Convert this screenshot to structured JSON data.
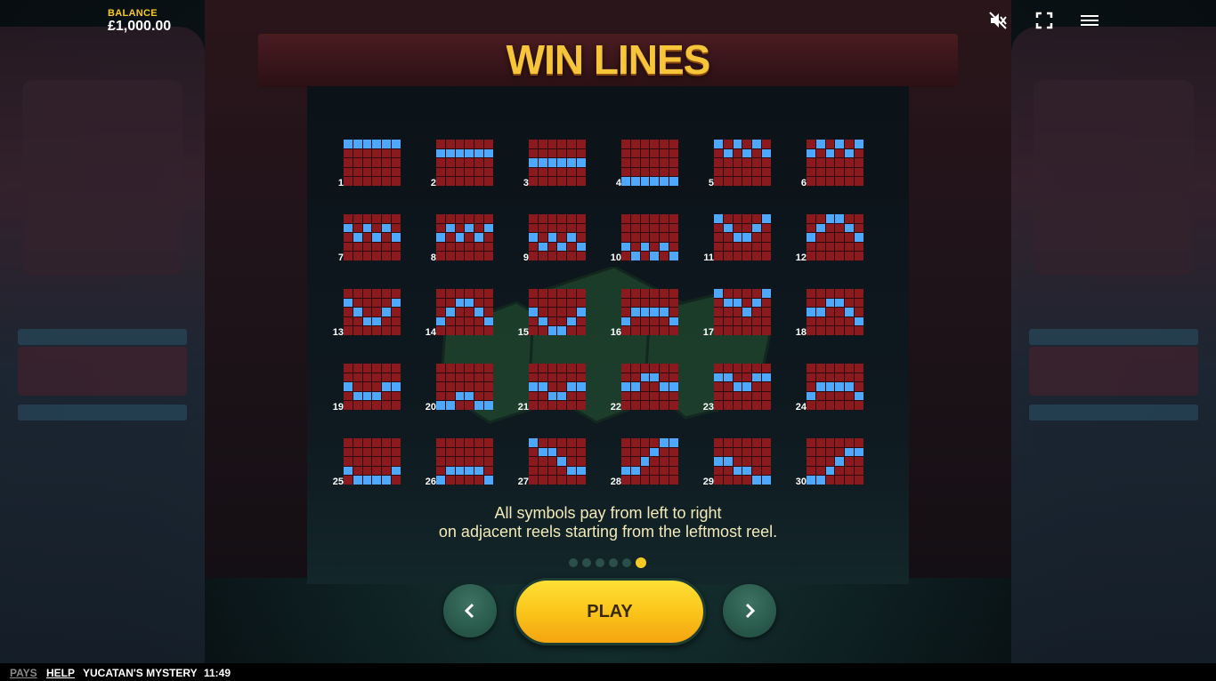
{
  "balance": {
    "label": "BALANCE",
    "value": "£1,000.00"
  },
  "top_icons": {
    "mute": "speaker-muted-icon",
    "fullscreen": "fullscreen-icon",
    "menu": "hamburger-menu-icon"
  },
  "title": "WIN LINES",
  "win_lines": [
    {
      "number": "1",
      "pattern": [
        0,
        0,
        0,
        0,
        0,
        0
      ]
    },
    {
      "number": "2",
      "pattern": [
        1,
        1,
        1,
        1,
        1,
        1
      ]
    },
    {
      "number": "3",
      "pattern": [
        2,
        2,
        2,
        2,
        2,
        2
      ]
    },
    {
      "number": "4",
      "pattern": [
        4,
        4,
        4,
        4,
        4,
        4
      ]
    },
    {
      "number": "5",
      "pattern": [
        0,
        1,
        0,
        1,
        0,
        1
      ]
    },
    {
      "number": "6",
      "pattern": [
        1,
        0,
        1,
        0,
        1,
        0
      ]
    },
    {
      "number": "7",
      "pattern": [
        1,
        2,
        1,
        2,
        1,
        2
      ]
    },
    {
      "number": "8",
      "pattern": [
        2,
        1,
        2,
        1,
        2,
        1
      ]
    },
    {
      "number": "9",
      "pattern": [
        2,
        3,
        2,
        3,
        2,
        3
      ]
    },
    {
      "number": "10",
      "pattern": [
        3,
        4,
        3,
        4,
        3,
        4
      ]
    },
    {
      "number": "11",
      "pattern": [
        0,
        1,
        2,
        2,
        1,
        0
      ]
    },
    {
      "number": "12",
      "pattern": [
        2,
        1,
        0,
        0,
        1,
        2
      ]
    },
    {
      "number": "13",
      "pattern": [
        1,
        2,
        3,
        3,
        2,
        1
      ]
    },
    {
      "number": "14",
      "pattern": [
        3,
        2,
        1,
        1,
        2,
        3
      ]
    },
    {
      "number": "15",
      "pattern": [
        2,
        3,
        4,
        4,
        3,
        2
      ]
    },
    {
      "number": "16",
      "pattern": [
        3,
        2,
        2,
        2,
        2,
        3
      ]
    },
    {
      "number": "17",
      "pattern": [
        0,
        1,
        1,
        2,
        1,
        0
      ]
    },
    {
      "number": "18",
      "pattern": [
        2,
        2,
        1,
        1,
        2,
        3
      ]
    },
    {
      "number": "19",
      "pattern": [
        2,
        3,
        3,
        3,
        2,
        2
      ]
    },
    {
      "number": "20",
      "pattern": [
        4,
        4,
        3,
        3,
        4,
        4
      ]
    },
    {
      "number": "21",
      "pattern": [
        2,
        2,
        3,
        3,
        2,
        2
      ]
    },
    {
      "number": "22",
      "pattern": [
        2,
        2,
        1,
        1,
        2,
        2
      ]
    },
    {
      "number": "23",
      "pattern": [
        1,
        1,
        2,
        2,
        1,
        1
      ]
    },
    {
      "number": "24",
      "pattern": [
        3,
        2,
        2,
        2,
        2,
        3
      ]
    },
    {
      "number": "25",
      "pattern": [
        3,
        4,
        4,
        4,
        4,
        3
      ]
    },
    {
      "number": "26",
      "pattern": [
        4,
        3,
        3,
        3,
        3,
        4
      ]
    },
    {
      "number": "27",
      "pattern": [
        0,
        1,
        1,
        2,
        3,
        3
      ]
    },
    {
      "number": "28",
      "pattern": [
        3,
        3,
        2,
        1,
        0,
        0
      ]
    },
    {
      "number": "29",
      "pattern": [
        2,
        2,
        3,
        3,
        4,
        4
      ]
    },
    {
      "number": "30",
      "pattern": [
        4,
        4,
        3,
        2,
        1,
        1
      ]
    }
  ],
  "colors": {
    "cell": "#8a1a1e",
    "highlight": "#4fa8ff",
    "accent": "#f6c925"
  },
  "footnote": {
    "line1": "All symbols pay from left to right",
    "line2": "on adjacent reels starting from the leftmost reel."
  },
  "pagination": {
    "total": 6,
    "active": 6
  },
  "buttons": {
    "prev": "chevron-left-icon",
    "play": "PLAY",
    "next": "chevron-right-icon"
  },
  "bottom_bar": {
    "pays": "PAYS",
    "help": "HELP",
    "game_name": "YUCATAN'S MYSTERY",
    "time": "11:49"
  }
}
